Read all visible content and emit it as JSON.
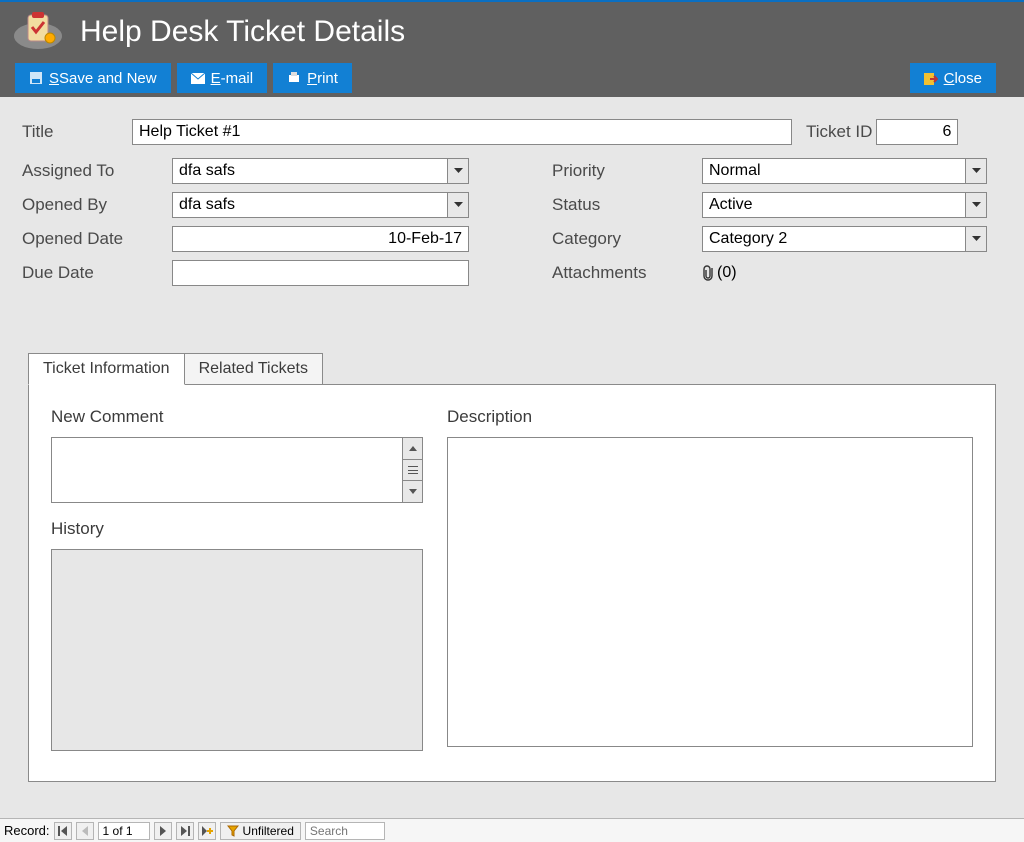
{
  "header": {
    "title": "Help Desk Ticket Details",
    "save_and_new": "Save and New",
    "email": "E-mail",
    "print": "Print",
    "close": "Close"
  },
  "form": {
    "title_label": "Title",
    "title_value": "Help Ticket #1",
    "ticket_id_label": "Ticket ID",
    "ticket_id_value": "6",
    "assigned_to_label": "Assigned To",
    "assigned_to_value": "dfa safs",
    "opened_by_label": "Opened By",
    "opened_by_value": "dfa safs",
    "opened_date_label": "Opened Date",
    "opened_date_value": "10-Feb-17",
    "due_date_label": "Due Date",
    "due_date_value": "",
    "priority_label": "Priority",
    "priority_value": "Normal",
    "status_label": "Status",
    "status_value": "Active",
    "category_label": "Category",
    "category_value": "Category 2",
    "attachments_label": "Attachments",
    "attachments_count": "(0)"
  },
  "tabs": {
    "ticket_info": "Ticket Information",
    "related": "Related Tickets"
  },
  "panel": {
    "new_comment_label": "New Comment",
    "history_label": "History",
    "description_label": "Description"
  },
  "statusbar": {
    "record_label": "Record:",
    "position": "1 of 1",
    "filter_label": "Unfiltered",
    "search_placeholder": "Search"
  }
}
